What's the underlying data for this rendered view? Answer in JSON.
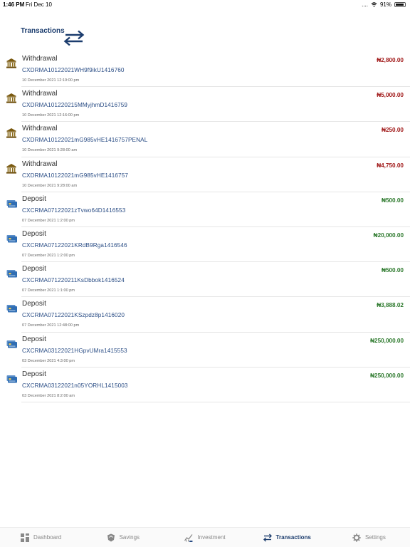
{
  "status": {
    "time": "1:46 PM",
    "date": "Fri Dec 10",
    "signal": "....",
    "battery": "91%",
    "battery_level": 0.91
  },
  "header": {
    "title": "Transactions"
  },
  "transactions": [
    {
      "type": "Withdrawal",
      "ref": "CXDRMA10122021WH9f9ikU1416760",
      "date": "10 December 2021 12:19:00 pm",
      "amount": "₦2,800.00",
      "direction": "out",
      "icon": "bank-icon"
    },
    {
      "type": "Withdrawal",
      "ref": "CXDRMA101220215MMyjhmD1416759",
      "date": "10 December 2021 12:16:00 pm",
      "amount": "₦5,000.00",
      "direction": "out",
      "icon": "bank-icon"
    },
    {
      "type": "Withdrawal",
      "ref": "CXDRMA10122021mG985vHE1416757PENAL",
      "date": "10 December 2021 9:28:00 am",
      "amount": "₦250.00",
      "direction": "out",
      "icon": "bank-icon"
    },
    {
      "type": "Withdrawal",
      "ref": "CXDRMA10122021mG985vHE1416757",
      "date": "10 December 2021 9:28:00 am",
      "amount": "₦4,750.00",
      "direction": "out",
      "icon": "bank-icon"
    },
    {
      "type": "Deposit",
      "ref": "CXCRMA07122021zTvwo64D1416553",
      "date": "07 December 2021 1:2:00 pm",
      "amount": "₦500.00",
      "direction": "in",
      "icon": "card-icon"
    },
    {
      "type": "Deposit",
      "ref": "CXCRMA07122021KRdB9Rga1416546",
      "date": "07 December 2021 1:2:00 pm",
      "amount": "₦20,000.00",
      "direction": "in",
      "icon": "card-icon"
    },
    {
      "type": "Deposit",
      "ref": "CXCRMA071220211KsDbbok1416524",
      "date": "07 December 2021 1:1:00 pm",
      "amount": "₦500.00",
      "direction": "in",
      "icon": "card-icon"
    },
    {
      "type": "Deposit",
      "ref": "CXCRMA07122021KSzpdz8p1416020",
      "date": "07 December 2021 12:48:00 pm",
      "amount": "₦3,888.02",
      "direction": "in",
      "icon": "card-icon"
    },
    {
      "type": "Deposit",
      "ref": "CXCRMA03122021HGpvUMra1415553",
      "date": "03 December 2021 4:3:00 pm",
      "amount": "₦250,000.00",
      "direction": "in",
      "icon": "card-icon"
    },
    {
      "type": "Deposit",
      "ref": "CXCRMA03122021n05YORHL1415003",
      "date": "03 December 2021 8:2:00 am",
      "amount": "₦250,000.00",
      "direction": "in",
      "icon": "card-icon"
    }
  ],
  "tabs": [
    {
      "label": "Dashboard",
      "icon": "dashboard-icon",
      "active": false
    },
    {
      "label": "Savings",
      "icon": "savings-icon",
      "active": false
    },
    {
      "label": "Investment",
      "icon": "investment-icon",
      "active": false
    },
    {
      "label": "Transactions",
      "icon": "transactions-icon",
      "active": true
    },
    {
      "label": "Settings",
      "icon": "gear-icon",
      "active": false
    }
  ],
  "colors": {
    "brand": "#1c3d6e",
    "debit": "#a11a1a",
    "credit": "#2e7a2e"
  }
}
